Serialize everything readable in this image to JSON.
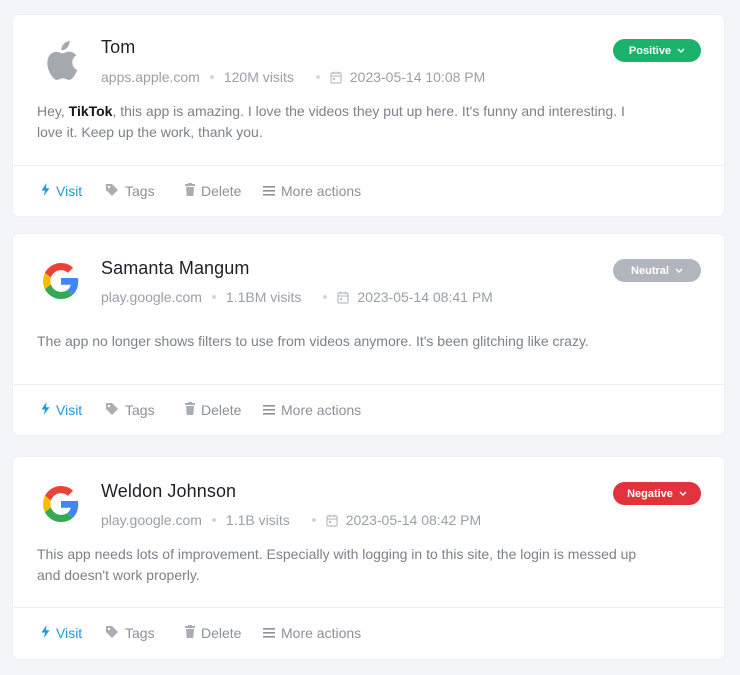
{
  "colors": {
    "positive": "#1bb26b",
    "neutral": "#b1b6be",
    "negative": "#e2333d",
    "visit_link": "#1f9ad6"
  },
  "actions": {
    "visit": "Visit",
    "tags": "Tags",
    "delete": "Delete",
    "more": "More actions"
  },
  "reviews": [
    {
      "name": "Tom",
      "source_icon": "apple-icon",
      "source": "apps.apple.com",
      "visits": "120M visits",
      "date": "2023-05-14 10:08 PM",
      "sentiment": "Positive",
      "text_before": "Hey, ",
      "text_bold": "TikTok",
      "text_after": ", this app is amazing. I love the videos they put up here. It's funny and interesting. I love it. Keep up the work, thank you."
    },
    {
      "name": "Samanta Mangum",
      "source_icon": "google-icon",
      "source": "play.google.com",
      "visits": "1.1BM visits",
      "date": "2023-05-14 08:41 PM",
      "sentiment": "Neutral",
      "text": "The app no longer shows filters to use from videos anymore. It's been glitching like crazy."
    },
    {
      "name": "Weldon Johnson",
      "source_icon": "google-icon",
      "source": "play.google.com",
      "visits": "1.1B visits",
      "date": "2023-05-14 08:42 PM",
      "sentiment": "Negative",
      "text": "This app needs lots of improvement. Especially with logging in to this site, the login is messed up and doesn't work properly."
    }
  ]
}
